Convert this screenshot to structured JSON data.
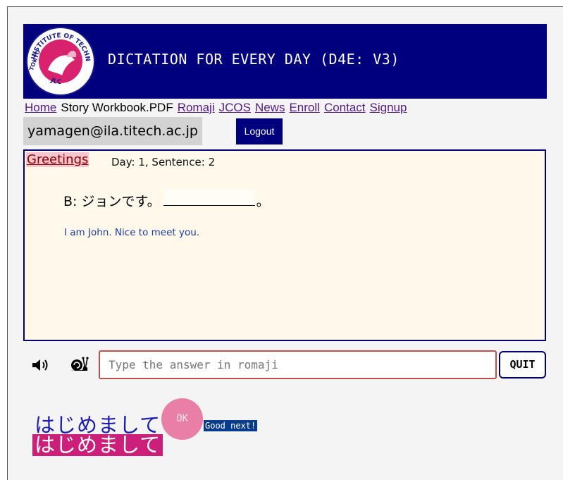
{
  "header": {
    "title": "DICTATION FOR EVERY DAY (D4E: V3)",
    "logo_top_text": "INSTITUTE OF TECHNOLOGY",
    "logo_left_text": "TOKYO",
    "logo_bottom_text": "JLC"
  },
  "nav": {
    "home": "Home",
    "story_workbook": "Story Workbook.PDF",
    "romaji": "Romaji",
    "jcos": "JCOS",
    "news": "News",
    "enroll": "Enroll",
    "contact": "Contact",
    "signup": "Signup"
  },
  "user": {
    "email": "yamagen@ila.titech.ac.jp",
    "logout_label": "Logout"
  },
  "lesson": {
    "title": "Greetings",
    "meta": "Day: 1, Sentence: 2",
    "sentence_prefix": "B: ジョンです。",
    "sentence_suffix": "。",
    "translation": "I am John. Nice to meet you."
  },
  "controls": {
    "speaker_icon": "speaker-icon",
    "slow_icon": "snail-icon",
    "input_placeholder": "Type the answer in romaji",
    "input_value": "",
    "quit_label": "QUIT"
  },
  "result": {
    "answer_kana": "はじめまして",
    "answer_highlight": "はじめまして",
    "ok_label": "OK",
    "next_label": "Good next!"
  },
  "colors": {
    "header_bg": "#00007f",
    "panel_bg": "#fff8eb",
    "highlight": "#cc1f7a",
    "ok_badge": "#e97fa6"
  }
}
